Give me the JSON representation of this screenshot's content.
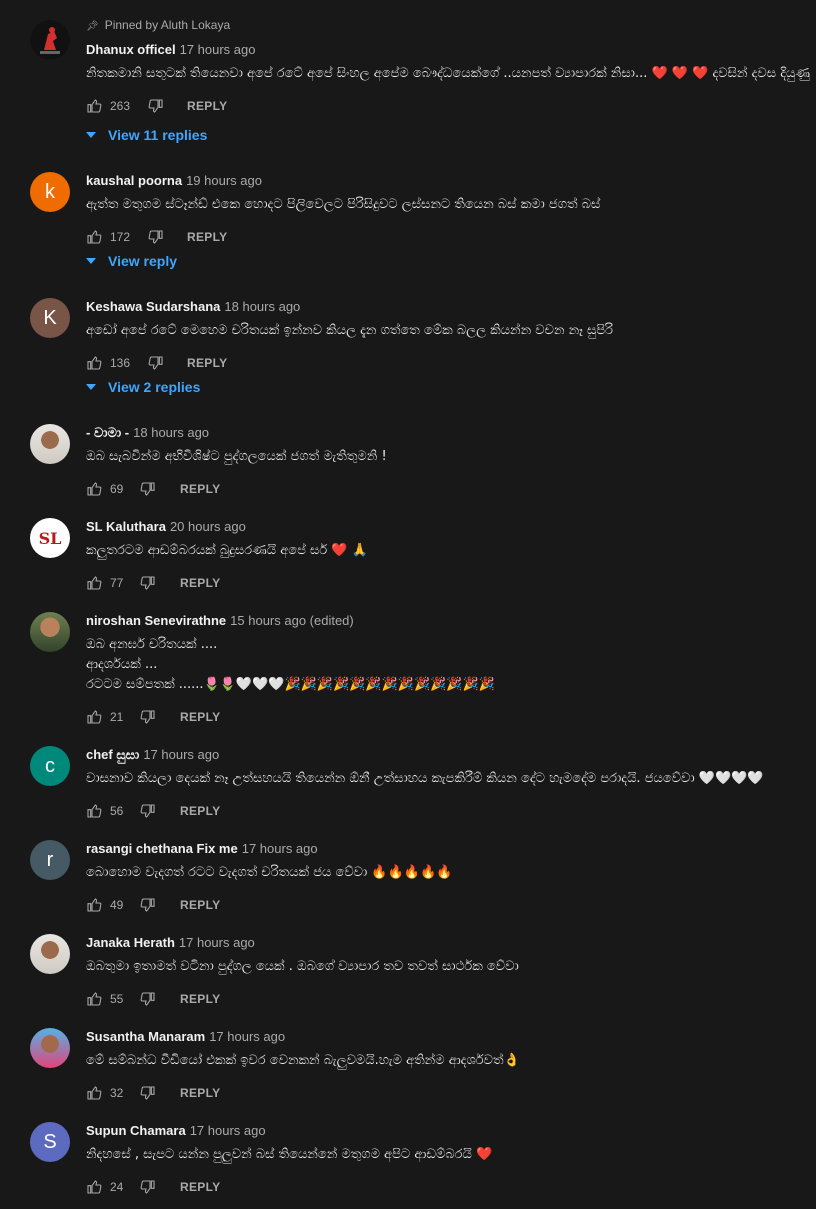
{
  "comments": [
    {
      "pinned_text": "Pinned by Aluth Lokaya",
      "author": "Dhanux officel",
      "time": "17 hours ago",
      "lines": [
        "නිතකමානි සතුටක් තියෙනවා අපේ රටේ අපේ සිංහල අපේම බෞද්ධයෙක්ගේ ..යනපත් ව්‍යාපාරක් නිසා... ❤️ ❤️ ❤️  දවසින් දවස දියුණු"
      ],
      "likes": "263",
      "reply_label": "REPLY",
      "view_replies": "View 11 replies",
      "avatar_letter": "",
      "avatar_color": "#1b1b1b"
    },
    {
      "author": "kaushal poorna",
      "time": "19 hours ago",
      "lines": [
        "ඇත්ත මතුගම ස්ටෑන්ඩ් එකෙ හොදට පිලිවෙලට පිරිසිදුවට ලස්සනට තියෙන බස් කමා ජගත් බස්"
      ],
      "likes": "172",
      "reply_label": "REPLY",
      "view_replies": "View reply",
      "avatar_letter": "k",
      "avatar_color": "#ef6c00"
    },
    {
      "author": "Keshawa Sudarshana",
      "time": "18 hours ago",
      "lines": [
        "අඩෝ අපේ රටේ මෙහෙම චරිතයක් ඉන්නව කියල දැන ගත්තෙ මේක බලල කියන්න වචන නෑ සුපිරි"
      ],
      "likes": "136",
      "reply_label": "REPLY",
      "view_replies": "View 2 replies",
      "avatar_letter": "K",
      "avatar_color": "#795548"
    },
    {
      "author": "- වාමා -",
      "time": "18 hours ago",
      "lines": [
        "ඔබ සැබවින්ම අභිවිශිෂ්ට පුද්ගලයෙක් ජගත් මැතිතුමනි !"
      ],
      "likes": "69",
      "reply_label": "REPLY",
      "avatar_letter": "",
      "avatar_color": "#cfcac3"
    },
    {
      "author": "SL Kaluthara",
      "time": "20 hours ago",
      "lines": [
        "කලුතරටම ආඩම්බරයක් බුදුසරණයි අපේ සර් ❤️ 🙏"
      ],
      "likes": "77",
      "reply_label": "REPLY",
      "avatar_letter": "SL",
      "avatar_color": "#ffffff"
    },
    {
      "author": "niroshan Senevirathne",
      "time": "15 hours ago (edited)",
      "lines": [
        "ඔබ අනර්ඝ චරිතයක් ....",
        "ආදර්ශයක් ...",
        "රටටම සම්පතක් ......🌷🌷🤍🤍🤍🎉🎉🎉🎉🎉🎉🎉🎉🎉🎉🎉🎉🎉"
      ],
      "likes": "21",
      "reply_label": "REPLY",
      "avatar_letter": "",
      "avatar_color": "#4a5b3a"
    },
    {
      "author": "chef සුසා",
      "time": "17 hours ago",
      "lines": [
        "වාසනාව කියලා දෙයක් නෑ උත්සහයයි තියෙන්න ඕනී උත්සාහය කැපකිරීම් කියන දේට හැමදේම පරාදයි. ජයවේවා 🤍🤍🤍🤍"
      ],
      "likes": "56",
      "reply_label": "REPLY",
      "avatar_letter": "c",
      "avatar_color": "#00897b"
    },
    {
      "author": "rasangi chethana Fix me",
      "time": "17 hours ago",
      "lines": [
        "බොහොම වැදගත් රටට වැදගත් චරිතයක් ජය වේවා 🔥🔥🔥🔥🔥"
      ],
      "likes": "49",
      "reply_label": "REPLY",
      "avatar_letter": "r",
      "avatar_color": "#455a64"
    },
    {
      "author": "Janaka Herath",
      "time": "17 hours ago",
      "lines": [
        "ඔබතුමා ඉතාමත් වටිනා පුද්ගල යෙක් . ඔබගේ ව්‍යාපාර තව තවත් සාර්ථක වේවා"
      ],
      "likes": "55",
      "reply_label": "REPLY",
      "avatar_letter": "",
      "avatar_color": "#e9e6e2"
    },
    {
      "author": "Susantha Manaram",
      "time": "17 hours ago",
      "lines": [
        "මේ සම්බන්ධ වීඩියෝ එකක් ඉවර වෙනකන් බැලුවමයි.හැම අතින්ම ආදර්ශවත්👌"
      ],
      "likes": "32",
      "reply_label": "REPLY",
      "avatar_letter": "",
      "avatar_color": "#55b2e6"
    },
    {
      "author": "Supun Chamara",
      "time": "17 hours ago",
      "lines": [
        "නිදහසේ , සැපට යන්න පුලුවන් බස් තියෙන්නේ මතුගම අපිට  ආඩම්බරයි ❤️"
      ],
      "likes": "24",
      "reply_label": "REPLY",
      "avatar_letter": "S",
      "avatar_color": "#5c6bc0"
    }
  ]
}
